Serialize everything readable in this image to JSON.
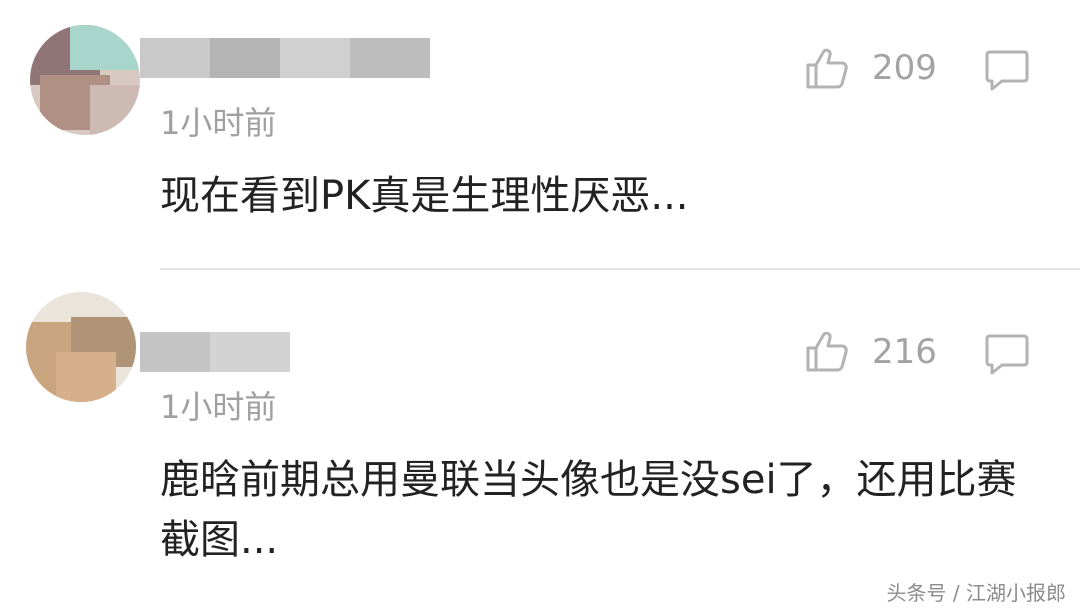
{
  "comments": [
    {
      "time": "1小时前",
      "likes": "209",
      "text": "现在看到PK真是生理性厌恶..."
    },
    {
      "time": "1小时前",
      "likes": "216",
      "text": "鹿晗前期总用曼联当头像也是没sei了，还用比赛截图..."
    }
  ],
  "watermark": "头条号 / 江湖小报郎",
  "colors": {
    "accent_gray": "#a3a3a3",
    "text": "#222222"
  },
  "icons": {
    "like": "thumbs-up-outline-icon",
    "reply": "speech-bubble-outline-icon"
  }
}
